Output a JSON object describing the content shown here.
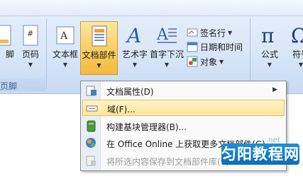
{
  "ribbon": {
    "left_partial": {
      "label_top": "脚",
      "label_caption": "页脚"
    },
    "page_number": {
      "label": "页码"
    },
    "text_box": {
      "label": "文本框"
    },
    "quick_parts": {
      "label": "文档部件"
    },
    "wordart": {
      "label": "艺术字"
    },
    "drop_cap": {
      "label": "首字下沉"
    },
    "signature_line": {
      "label": "签名行"
    },
    "date_time": {
      "label": "日期和时间"
    },
    "object": {
      "label": "对象"
    },
    "equation": {
      "label": "公式"
    },
    "symbol": {
      "label": "符号"
    }
  },
  "menu": {
    "items": [
      {
        "label": "文档属性(D)",
        "icon": "document-properties-icon",
        "has_submenu": true
      },
      {
        "label": "域(F)...",
        "icon": "field-icon",
        "highlighted": true
      },
      {
        "label": "构建基块管理器(B)...",
        "icon": "building-blocks-icon"
      },
      {
        "label": "在 Office Online 上获取更多文档部件(G)...",
        "icon": "office-online-icon"
      },
      {
        "label": "将所选内容保存到文档部件库(S)...",
        "icon": "save-selection-icon",
        "disabled": true
      }
    ]
  },
  "watermark": {
    "text": "匀阳教程网",
    "net": ".net"
  },
  "colors": {
    "ribbon_bg": "#d9e7f8",
    "active_button": "#fbd168",
    "menu_highlight": "#ffe59a"
  }
}
